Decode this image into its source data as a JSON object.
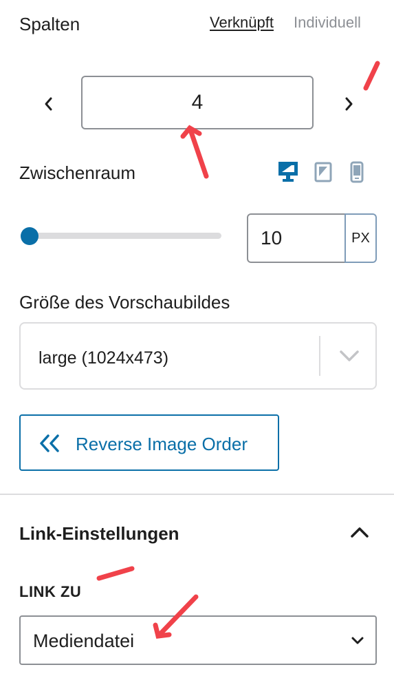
{
  "columns": {
    "label": "Spalten",
    "tabs": {
      "linked": "Verknüpft",
      "individual": "Individuell"
    },
    "value": "4",
    "prev_icon": "chevron-left-icon",
    "next_icon": "chevron-right-icon"
  },
  "gap": {
    "label": "Zwischenraum",
    "devices": [
      "desktop-icon",
      "tablet-icon",
      "mobile-icon"
    ],
    "value": "10",
    "unit": "PX",
    "slider_fraction": 0.0
  },
  "thumbnail": {
    "label": "Größe des Vorschaubildes",
    "selected": "large (1024x473)"
  },
  "reverse_button": {
    "label": "Reverse Image Order",
    "icon": "double-chevron-left-icon"
  },
  "link_settings": {
    "title": "Link-Einstellungen",
    "link_to_label": "LINK ZU",
    "link_to_value": "Mediendatei"
  },
  "colors": {
    "accent": "#0a6fa8",
    "text": "#1e1e1e",
    "muted": "#8c8f94",
    "annotation": "#f0424a"
  }
}
